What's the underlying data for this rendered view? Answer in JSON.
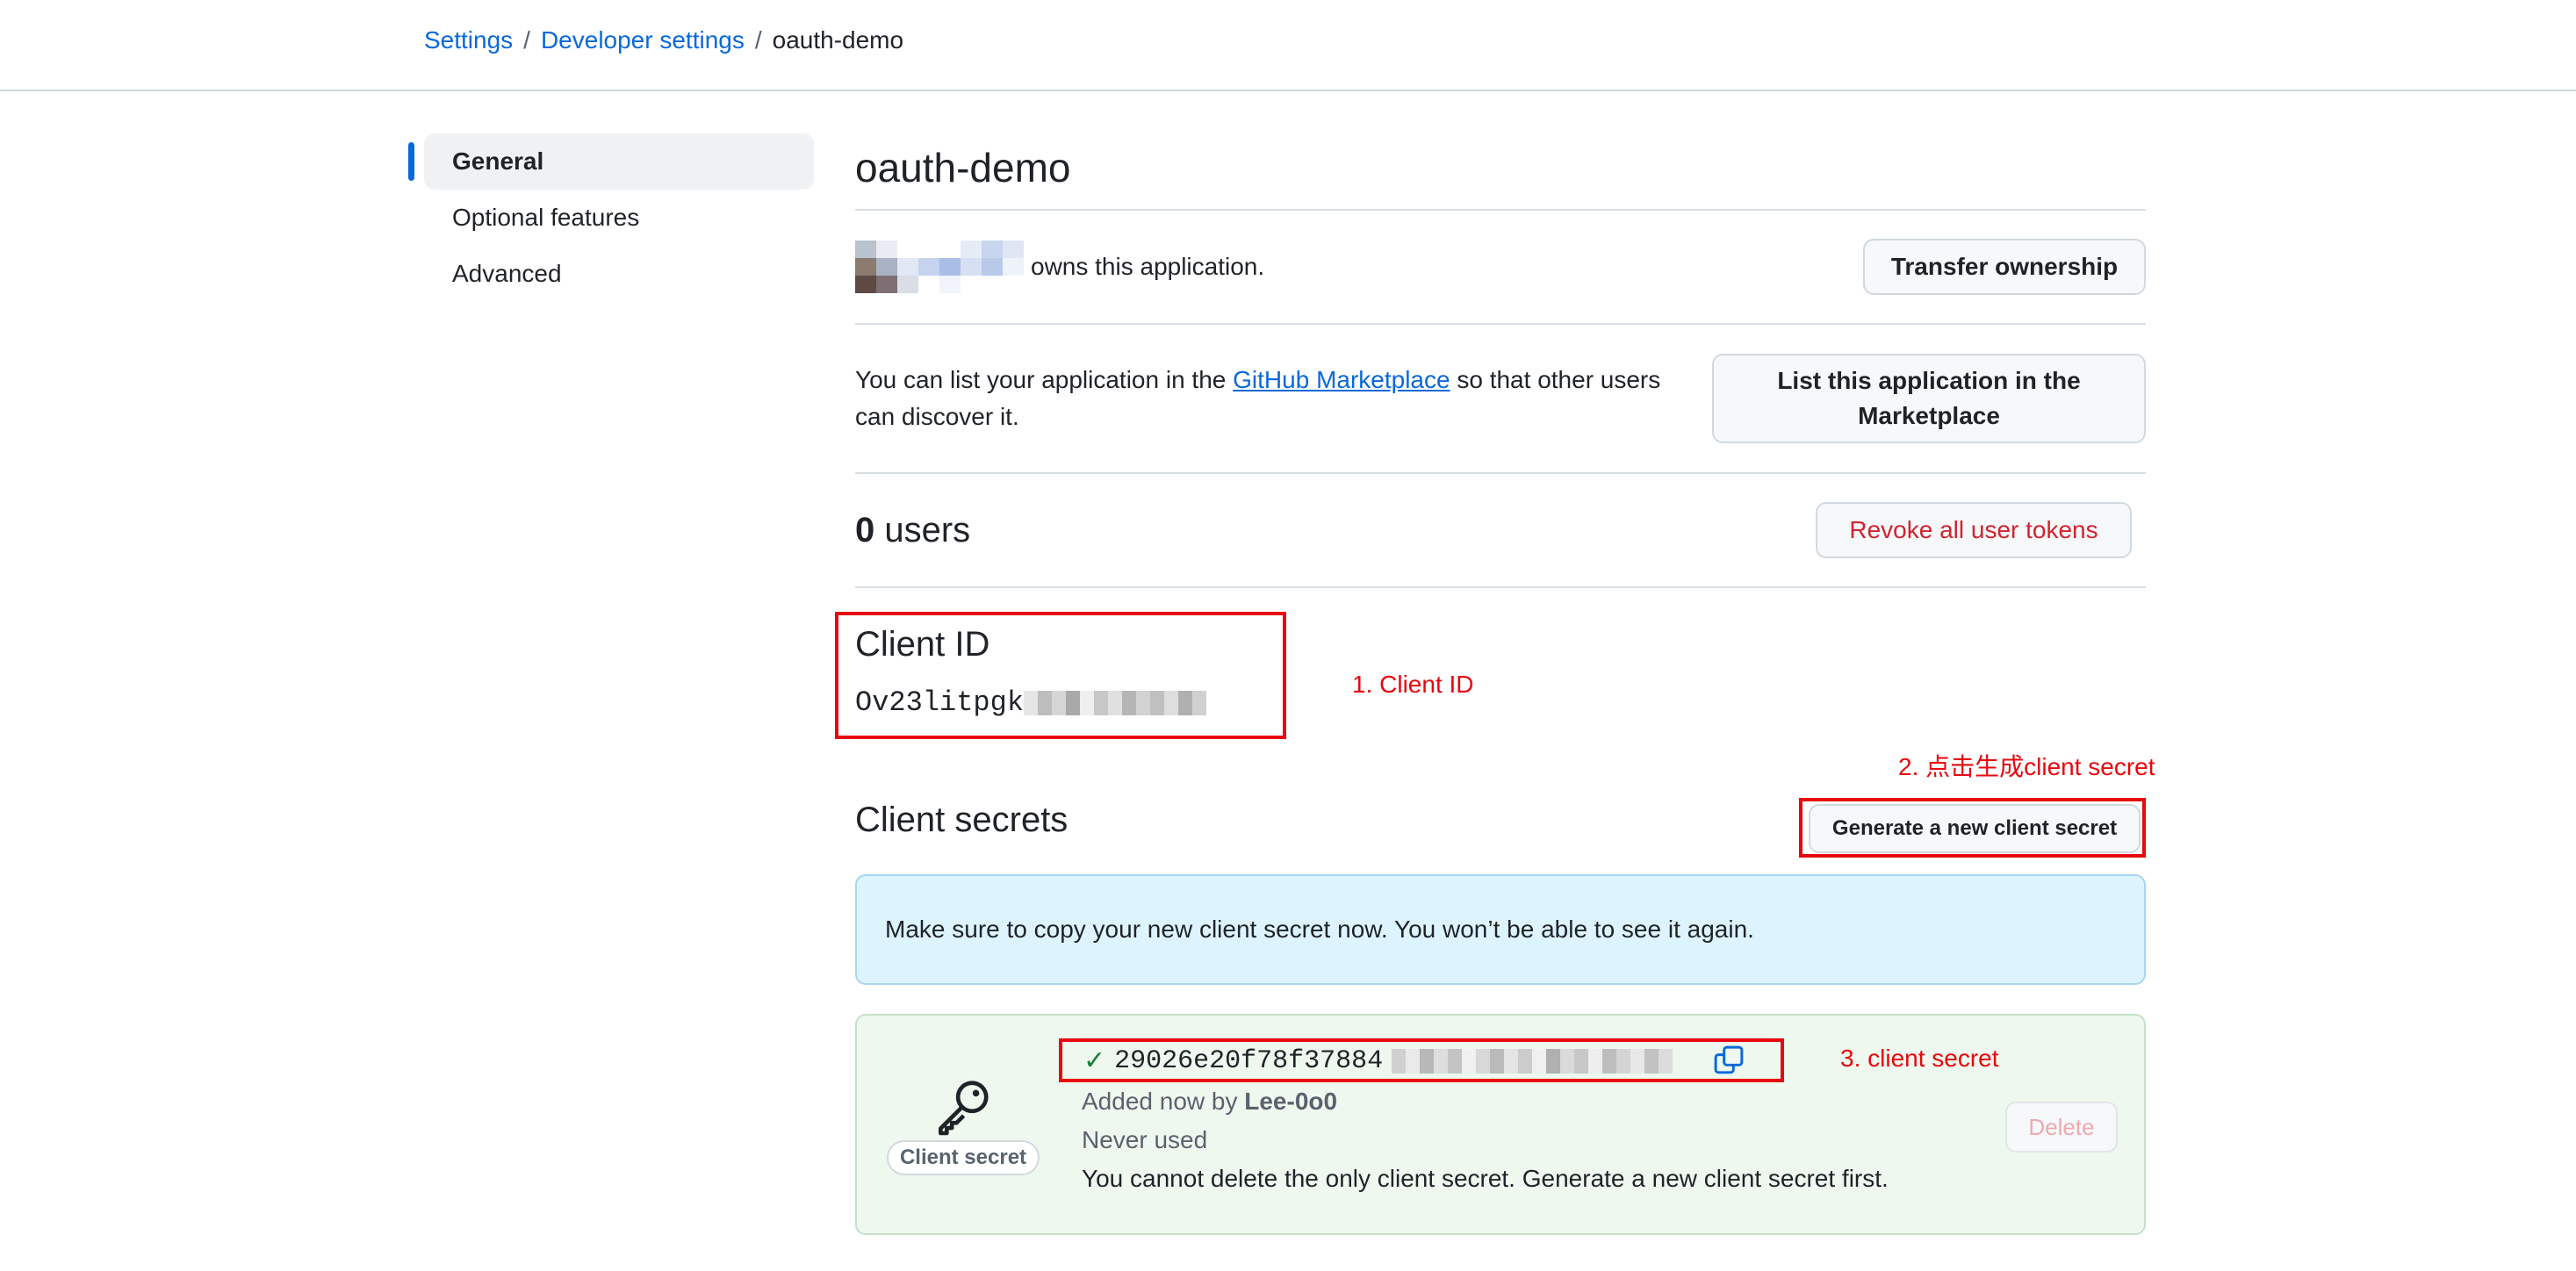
{
  "breadcrumb": {
    "settings": "Settings",
    "sep1": "/",
    "developer": "Developer settings",
    "sep2": "/",
    "current": "oauth-demo"
  },
  "sidebar": {
    "items": [
      {
        "label": "General",
        "active": true
      },
      {
        "label": "Optional features"
      },
      {
        "label": "Advanced"
      }
    ]
  },
  "app": {
    "title": "oauth-demo",
    "owner_text": "owns this application.",
    "transfer_button": "Transfer ownership",
    "market_text_before": "You can list your application in the ",
    "market_link": "GitHub Marketplace",
    "market_text_after": " so that other users can discover it.",
    "market_button": "List this application in the Marketplace",
    "users_count": "0",
    "users_label": " users",
    "revoke_button": "Revoke all user tokens"
  },
  "client_id": {
    "title": "Client ID",
    "value_prefix": "Ov23litpgk"
  },
  "annotations": {
    "a1": "1. Client ID",
    "a2": "2. 点击生成client secret",
    "a3": "3. client secret"
  },
  "secrets": {
    "title": "Client secrets",
    "generate_button": "Generate a new client secret",
    "flash": "Make sure to copy your new client secret now. You won’t be able to see it again.",
    "badge": "Client secret",
    "value_prefix": "29026e20f78f37884",
    "added_by_prefix": "Added now by ",
    "added_by_user": "Lee-0o0",
    "usage": "Never used",
    "note": "You cannot delete the only client secret. Generate a new client secret first.",
    "delete_button": "Delete"
  },
  "colors": {
    "link": "#0969da",
    "annotation": "#e8070e",
    "danger": "#d1242f",
    "success": "#1a7f37"
  }
}
